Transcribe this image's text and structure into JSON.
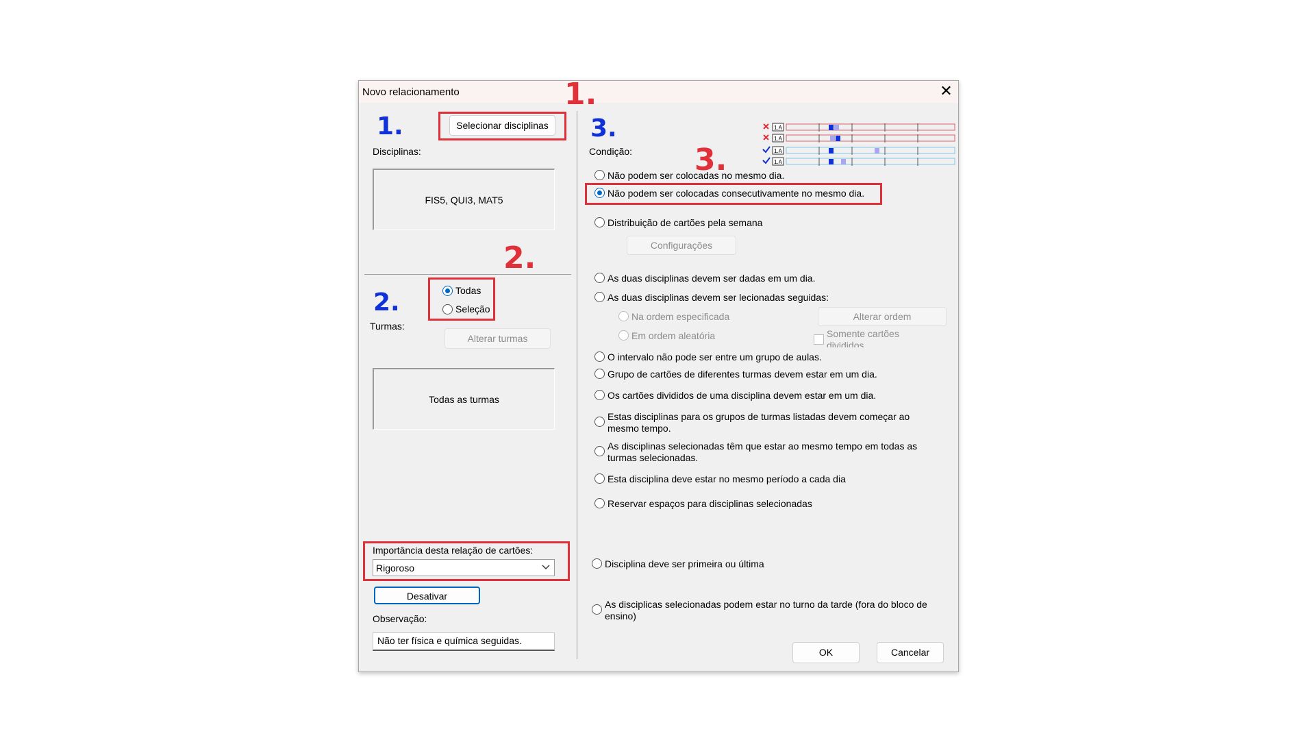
{
  "dialog": {
    "title": "Novo relacionamento",
    "close": "✕"
  },
  "left": {
    "select_subjects_button": "Selecionar disciplinas",
    "subjects_label": "Disciplinas:",
    "subjects_value": "FIS5, QUI3, MAT5",
    "classes_label": "Turmas:",
    "radio_all": "Todas",
    "radio_selection": "Seleção",
    "change_classes_button": "Alterar turmas",
    "classes_value": "Todas as turmas",
    "importance_label": "Importância desta relação de cartões:",
    "importance_value": "Rigoroso",
    "deactivate_button": "Desativar",
    "note_label": "Observação:",
    "note_value": "Não ter física e química seguidas."
  },
  "right": {
    "condition_label": "Condição:",
    "preview_badge": "1.A",
    "options": [
      {
        "label": "Não podem ser colocadas no mesmo dia.",
        "checked": false
      },
      {
        "label": "Não podem ser colocadas consecutivamente no mesmo dia.",
        "checked": true
      },
      {
        "label": "Distribuição de cartões pela semana",
        "checked": false
      },
      {
        "label": "As duas disciplinas devem ser dadas em um dia.",
        "checked": false
      },
      {
        "label": "As duas disciplinas devem ser lecionadas seguidas:",
        "checked": false
      },
      {
        "label": "O intervalo não pode ser entre um grupo de aulas.",
        "checked": false
      },
      {
        "label": "Grupo de cartões de diferentes turmas devem estar em um dia.",
        "checked": false
      },
      {
        "label": "Os cartões divididos de uma disciplina devem estar em um dia.",
        "checked": false
      },
      {
        "label": "Estas disciplinas para os grupos de turmas listadas devem começar ao mesmo tempo.",
        "checked": false
      },
      {
        "label": "As disciplinas selecionadas têm que estar ao mesmo tempo em todas as turmas selecionadas.",
        "checked": false
      },
      {
        "label": "Esta disciplina deve estar no mesmo período a cada dia",
        "checked": false
      },
      {
        "label": "Reservar espaços para disciplinas selecionadas",
        "checked": false
      },
      {
        "label": "Disciplina deve ser primeira ou última",
        "checked": false
      },
      {
        "label": "As disciplicas selecionadas podem estar no turno da tarde (fora do bloco de ensino)",
        "checked": false
      }
    ],
    "settings_button": "Configurações",
    "order_specified": "Na ordem especificada",
    "order_random": "Em ordem aleatória",
    "change_order_button": "Alterar ordem",
    "only_split_cards": "Somente cartões divididos.",
    "ok_button": "OK",
    "cancel_button": "Cancelar"
  },
  "annotations": {
    "red_1": "1.",
    "red_2": "2.",
    "red_3": "3.",
    "blue_1": "1.",
    "blue_2": "2.",
    "blue_3": "3."
  },
  "colors": {
    "annotation_red": "#e0303a",
    "annotation_blue": "#1030d8",
    "accent": "#0067c0"
  }
}
